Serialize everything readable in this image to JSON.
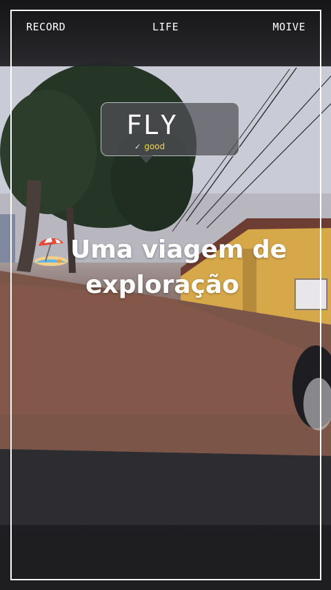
{
  "nav": {
    "record": "RECORD",
    "life": "LIFE",
    "moive": "MOIVE"
  },
  "badge": {
    "title": "FLY",
    "subtitle": "good"
  },
  "caption": {
    "line1": "Uma viagem de",
    "line2": "exploração",
    "icon": "beach-umbrella-icon"
  },
  "colors": {
    "frame": "#ffffff",
    "badge_subtitle": "#f5d54a",
    "wall": "#d8a94a"
  }
}
